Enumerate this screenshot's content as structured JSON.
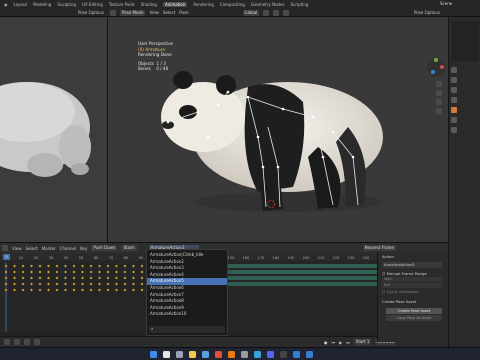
{
  "top_menu": [
    "Layout",
    "Modeling",
    "Sculpting",
    "UV Editing",
    "Texture Paint",
    "Shading",
    "Animation",
    "Rendering",
    "Compositing",
    "Geometry Nodes",
    "Scripting"
  ],
  "active_tab": "Animation",
  "scene": "Scene",
  "header": {
    "pose_mode": "Pose Mode",
    "view": "View",
    "select": "Select",
    "pose": "Pose",
    "transform": "Global",
    "left_pose_options": "Pose Options",
    "right_pose_options": "Pose Options"
  },
  "viewport_overlay": {
    "line1": "User Perspective",
    "line2": "(0) Armature",
    "line3": "Rendering Done",
    "objects_label": "Objects",
    "objects_value": "1 / 3",
    "bones_label": "Bones",
    "bones_value": "0 / 46"
  },
  "timeline_header": {
    "mode": "Dope Sheet",
    "view": "View",
    "select": "Select",
    "marker": "Marker",
    "channel": "Channel",
    "key": "Key",
    "push_down": "Push Down",
    "stash": "Stash",
    "action_name": "ArmatureAction3",
    "nearest_frame": "Nearest Frame"
  },
  "ruler_ticks": [
    "0",
    "10",
    "20",
    "30",
    "40",
    "50",
    "60",
    "70",
    "80",
    "90",
    "100",
    "110",
    "120",
    "130",
    "140",
    "150",
    "160",
    "170",
    "180",
    "190",
    "200",
    "210",
    "220",
    "230",
    "240",
    "250"
  ],
  "action_dropdown": {
    "items": [
      "ArmatureAction|Climb_Idle",
      "ArmatureAction2",
      "ArmatureAction3",
      "ArmatureAction4",
      "ArmatureAction5",
      "ArmatureAction6",
      "ArmatureAction7",
      "ArmatureAction8",
      "ArmatureAction9",
      "ArmatureAction10"
    ],
    "selected_index": 4,
    "search_placeholder": ""
  },
  "action_panel": {
    "section": "Action",
    "action": "ArmatureAction3",
    "manual_frame_range": "Manual Frame Range",
    "start": "Start",
    "end": "End",
    "cyclic": "Cyclic Animation",
    "create_pose_asset_title": "Create Pose Asset",
    "create_pose_asset": "Create Pose Asset",
    "copy_pose_as_asset": "Copy Pose as Asset"
  },
  "playback": {
    "start_label": "Start",
    "start": "1",
    "end_label": "End",
    "end": "250"
  },
  "taskbar_icons": [
    "windows",
    "search",
    "task-view",
    "explorer",
    "store",
    "chrome",
    "blender",
    "settings",
    "photos",
    "discord",
    "terminal",
    "mail",
    "calendar"
  ],
  "colors": {
    "accent": "#4772b3",
    "active_tab_bg": "#4a4a4a",
    "keyframe": "#d9a72e",
    "strip": "#2f5e53"
  }
}
